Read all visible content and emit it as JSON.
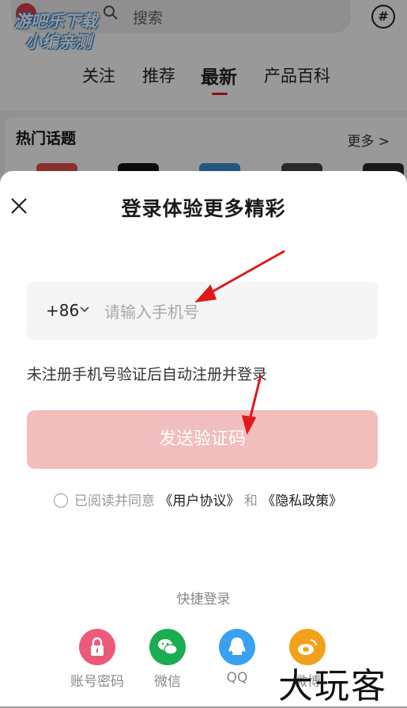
{
  "background": {
    "search_placeholder": "搜索",
    "nav_tabs": [
      "关注",
      "推荐",
      "最新",
      "产品百科"
    ],
    "active_tab": "最新",
    "hot_topics_title": "热门话题",
    "hot_topics_more": "更多 >",
    "watermark_top_line1": "游吧乐下载",
    "watermark_top_line2": "小编亲测"
  },
  "login_sheet": {
    "title": "登录体验更多精彩",
    "country_code": "+86",
    "phone_placeholder": "请输入手机号",
    "hint": "未注册手机号验证后自动注册并登录",
    "send_button": "发送验证码",
    "agree_prefix": "已阅读并同意",
    "user_agreement": "《用户协议》",
    "and": "和",
    "privacy_policy": "《隐私政策》",
    "quick_login_label": "快捷登录",
    "quick_login": [
      {
        "label": "账号密码",
        "icon": "lock-icon",
        "color": "#ec5a79"
      },
      {
        "label": "微信",
        "icon": "wechat-icon",
        "color": "#1aad52"
      },
      {
        "label": "QQ",
        "icon": "qq-icon",
        "color": "#3aa0f0"
      },
      {
        "label": "微博",
        "icon": "weibo-icon",
        "color": "#f2a11b"
      }
    ]
  },
  "watermark_bottom": "大玩客",
  "colors": {
    "accent": "#d22222",
    "send_button_disabled": "#f1bdbd",
    "annotation_arrow": "#e01818"
  }
}
